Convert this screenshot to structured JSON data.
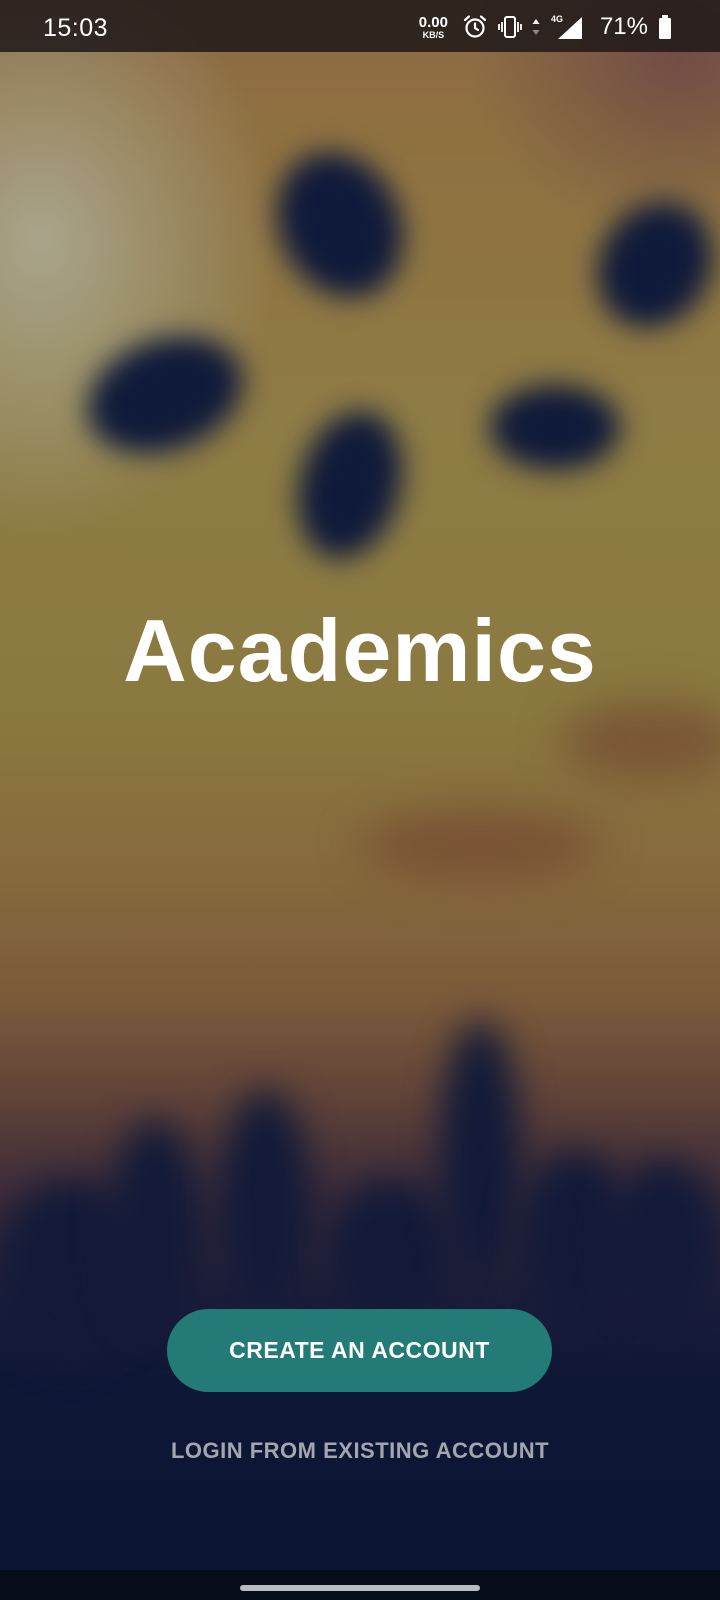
{
  "status_bar": {
    "time": "15:03",
    "net_speed_value": "0.00",
    "net_speed_unit": "KB/S",
    "network_type": "4G",
    "battery_percent": "71%",
    "icons": [
      "alarm-icon",
      "vibrate-icon",
      "data-arrows-icon",
      "signal-icon",
      "battery-icon"
    ]
  },
  "main": {
    "title": "Academics",
    "create_account_label": "CREATE AN ACCOUNT",
    "login_label": "LOGIN FROM EXISTING ACCOUNT"
  },
  "colors": {
    "primary_button": "#237a76",
    "title_text": "#ffffff",
    "secondary_text": "#a3a6ae",
    "background_dark": "#0b1533"
  }
}
